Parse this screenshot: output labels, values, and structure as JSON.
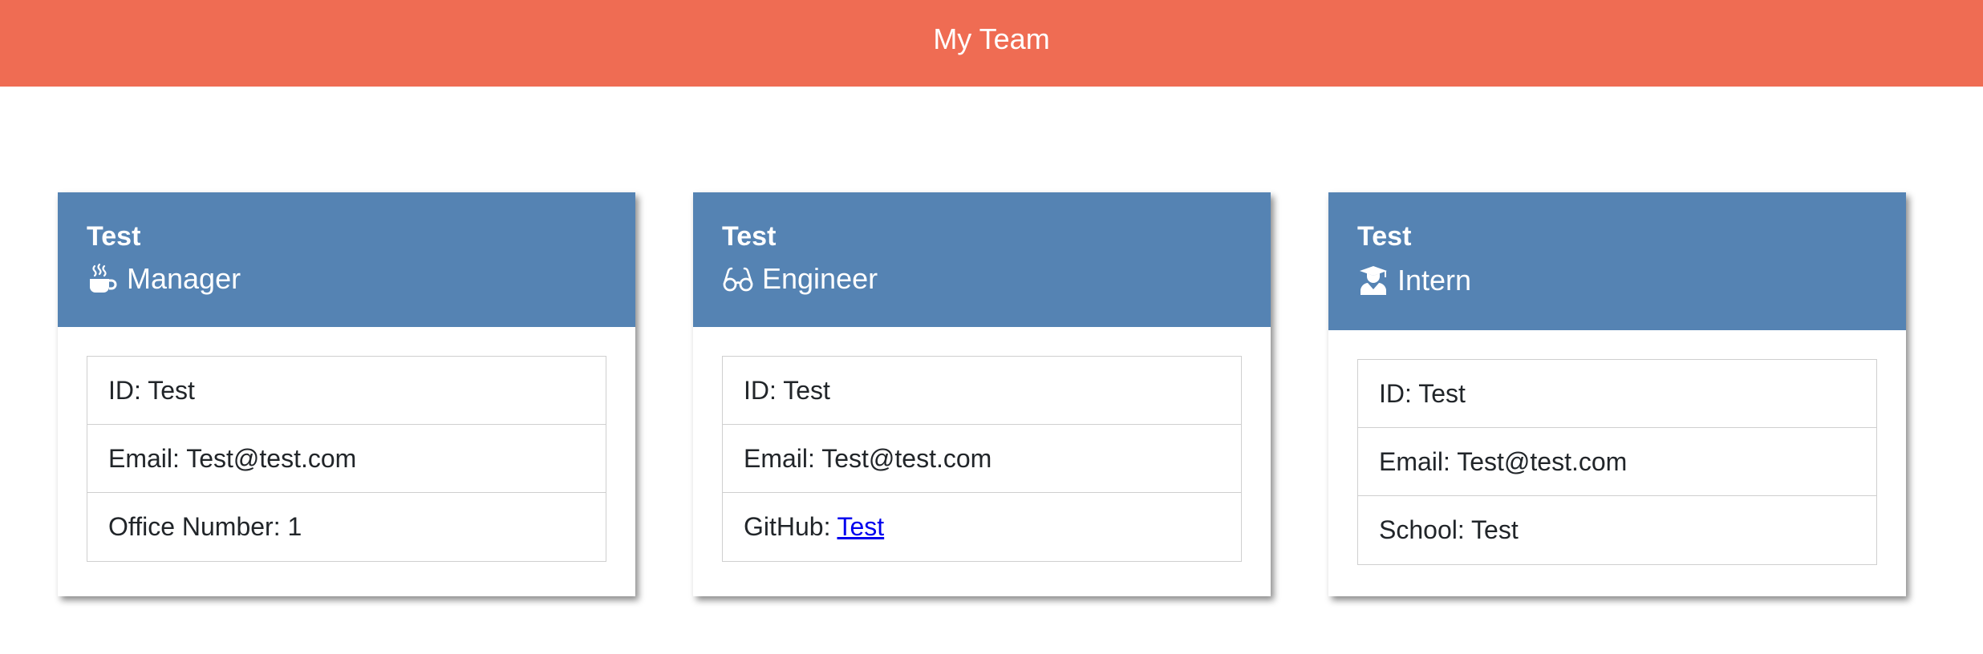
{
  "header": {
    "title": "My Team"
  },
  "colors": {
    "header_bg": "#ef6c53",
    "card_header_bg": "#5583b3",
    "link": "#0000ee"
  },
  "cards": [
    {
      "name": "Test",
      "role": "Manager",
      "role_icon": "mug-hot-icon",
      "items": [
        {
          "text": "ID: Test"
        },
        {
          "text": "Email: Test@test.com"
        },
        {
          "text": "Office Number: 1"
        }
      ]
    },
    {
      "name": "Test",
      "role": "Engineer",
      "role_icon": "glasses-icon",
      "items": [
        {
          "text": "ID: Test"
        },
        {
          "text": "Email: Test@test.com"
        },
        {
          "label": "GitHub:",
          "link_text": "Test"
        }
      ]
    },
    {
      "name": "Test",
      "role": "Intern",
      "role_icon": "user-graduate-icon",
      "items": [
        {
          "text": "ID: Test"
        },
        {
          "text": "Email: Test@test.com"
        },
        {
          "text": "School: Test"
        }
      ]
    }
  ]
}
